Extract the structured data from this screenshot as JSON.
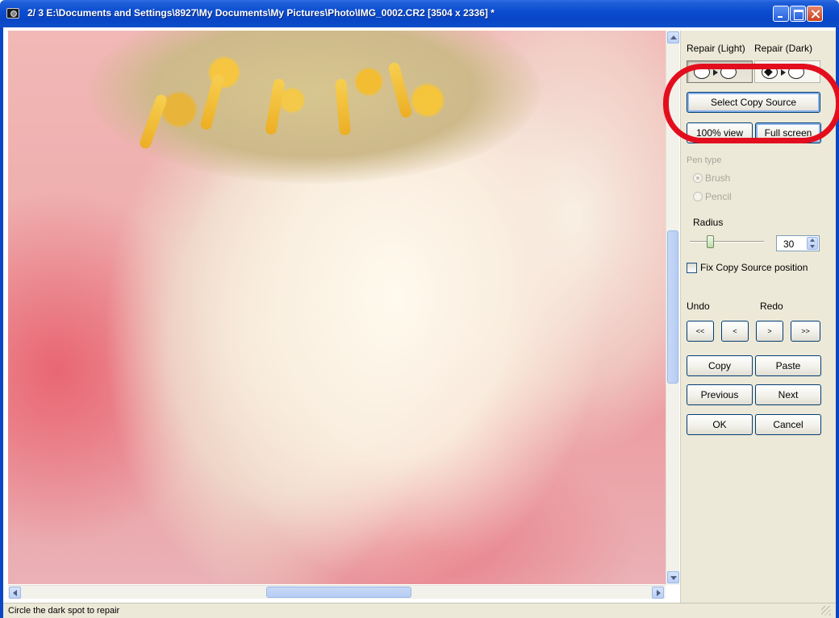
{
  "window": {
    "title": "2/  3  E:\\Documents and Settings\\8927\\My Documents\\My Pictures\\Photo\\IMG_0002.CR2 [3504 x 2336] *"
  },
  "panel": {
    "repair_light_label": "Repair (Light)",
    "repair_dark_label": "Repair (Dark)",
    "select_copy_source": "Select Copy Source",
    "view_100": "100% view",
    "full_screen": "Full screen",
    "pen_type_label": "Pen type",
    "brush_label": "Brush",
    "pencil_label": "Pencil",
    "radius_label": "Radius",
    "radius_value": "30",
    "fix_copy_source": "Fix Copy Source position",
    "undo_label": "Undo",
    "redo_label": "Redo",
    "undo_all": "<<",
    "undo_one": "<",
    "redo_one": ">",
    "redo_all": ">>",
    "copy": "Copy",
    "paste": "Paste",
    "previous": "Previous",
    "next": "Next",
    "ok": "OK",
    "cancel": "Cancel"
  },
  "status": {
    "text": "Circle the dark spot to repair"
  },
  "colors": {
    "title_bar": "#0a4cd0",
    "highlight_ring": "#e30e1d",
    "panel_bg": "#ece9d8"
  }
}
